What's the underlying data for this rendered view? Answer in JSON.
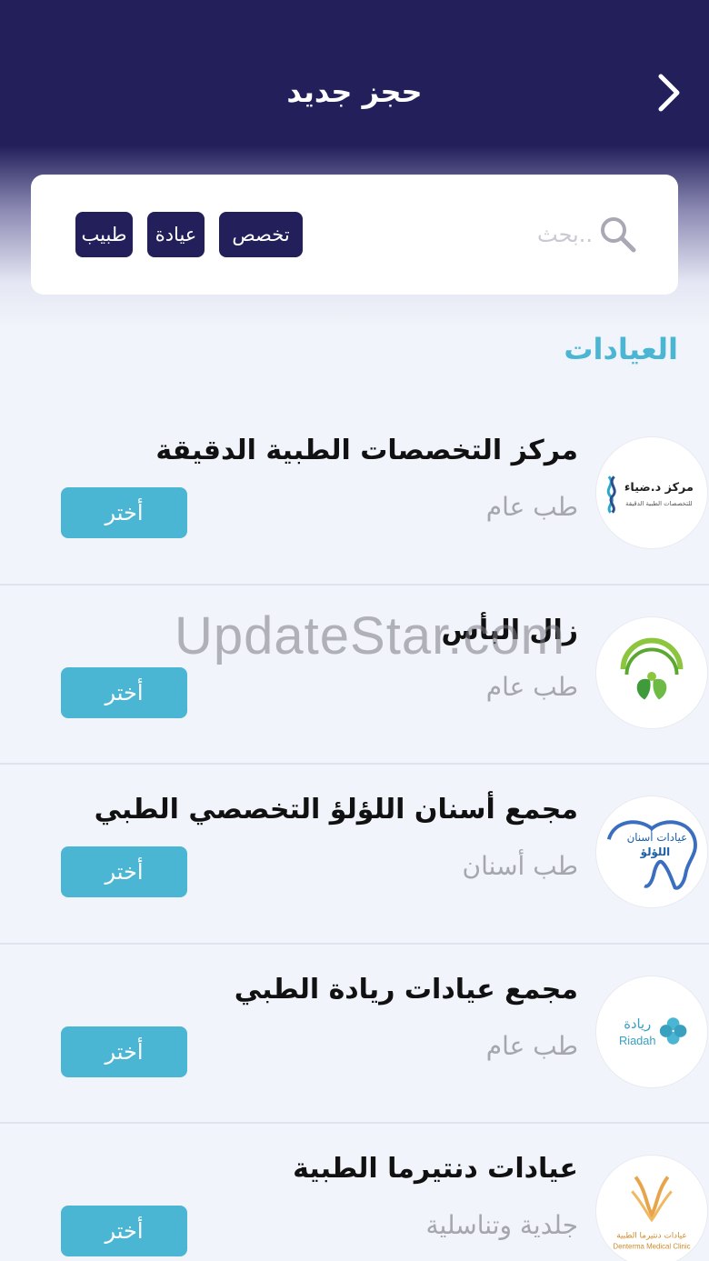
{
  "header": {
    "title": "حجز جديد",
    "back_icon": "chevron-right-icon"
  },
  "search": {
    "placeholder": "..بحث",
    "icon": "search-icon",
    "filters": [
      "تخصص",
      "عيادة",
      "طبيب"
    ]
  },
  "section": {
    "title": "العيادات"
  },
  "clinics": [
    {
      "name": "مركز التخصصات الطبية الدقيقة",
      "specialty": "طب عام",
      "button_label": "أختر",
      "logo": {
        "line1": "مركز د.ضياء",
        "line2": "للتخصصات الطبية الدقيقة"
      }
    },
    {
      "name": "زال البأس",
      "specialty": "طب عام",
      "button_label": "أختر",
      "logo": {
        "icon": "leaf-people-logo"
      }
    },
    {
      "name": "مجمع أسنان اللؤلؤ التخصصي الطبي",
      "specialty": "طب أسنان",
      "button_label": "أختر",
      "logo": {
        "line1": "عيادات أسنان",
        "line2": "اللؤلؤ"
      }
    },
    {
      "name": "مجمع عيادات ريادة الطبي",
      "specialty": "طب عام",
      "button_label": "أختر",
      "logo": {
        "line1": "ريادة",
        "line2": "Riadah"
      }
    },
    {
      "name": "عيادات دنتيرما الطبية",
      "specialty": "جلدية وتناسلية",
      "button_label": "أختر",
      "logo": {
        "line1": "عيادات دنتيرما الطبية",
        "line2": "Denterma Medical Clinic"
      }
    }
  ],
  "watermark": "UpdateStar.com",
  "colors": {
    "header_bg": "#221f5b",
    "accent": "#4bb6d3",
    "chip_bg": "#221f5b",
    "page_bg": "#f2f4fb"
  }
}
